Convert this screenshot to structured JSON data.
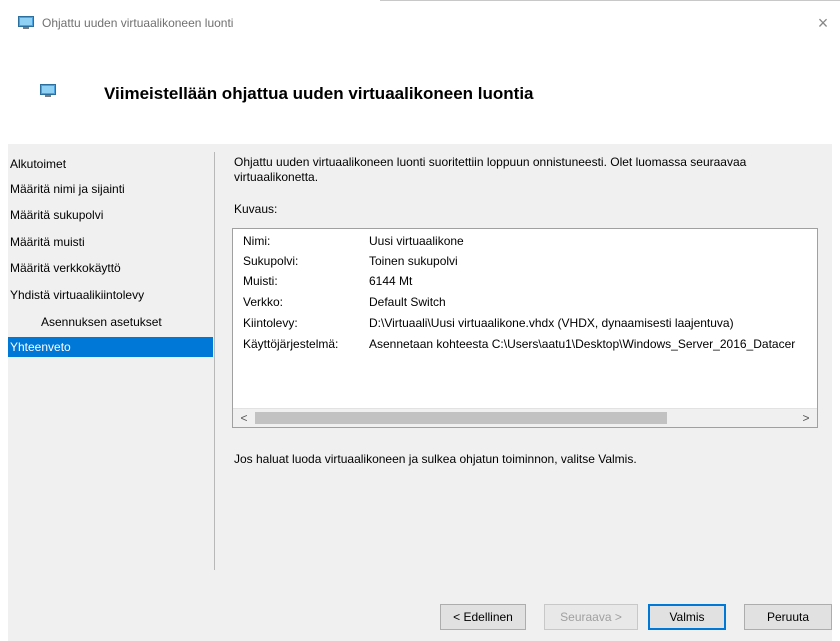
{
  "window": {
    "title": "Ohjattu uuden virtuaalikoneen luonti",
    "close_glyph": "×"
  },
  "header": {
    "title": "Viimeistellään ohjattua uuden virtuaalikoneen luontia"
  },
  "nav": {
    "items": [
      {
        "label": "Alkutoimet",
        "selected": false
      },
      {
        "label": "Määritä nimi ja sijainti",
        "selected": false
      },
      {
        "label": "Määritä sukupolvi",
        "selected": false
      },
      {
        "label": "Määritä muisti",
        "selected": false
      },
      {
        "label": "Määritä verkkokäyttö",
        "selected": false
      },
      {
        "label": "Yhdistä virtuaalikiintolevy",
        "selected": false
      },
      {
        "label": "Asennuksen asetukset",
        "selected": false
      },
      {
        "label": "Yhteenveto",
        "selected": true
      }
    ]
  },
  "content": {
    "intro": "Ohjattu uuden virtuaalikoneen luonti suoritettiin loppuun onnistuneesti. Olet luomassa seuraavaa virtuaalikonetta.",
    "description_label": "Kuvaus:",
    "summary": [
      {
        "key": "Nimi:",
        "value": "Uusi virtuaalikone"
      },
      {
        "key": "Sukupolvi:",
        "value": "Toinen sukupolvi"
      },
      {
        "key": "Muisti:",
        "value": "6144 Mt"
      },
      {
        "key": "Verkko:",
        "value": "Default Switch"
      },
      {
        "key": "Kiintolevy:",
        "value": "D:\\Virtuaali\\Uusi virtuaalikone.vhdx (VHDX, dynaamisesti laajentuva)"
      },
      {
        "key": "Käyttöjärjestelmä:",
        "value": "Asennetaan kohteesta C:\\Users\\aatu1\\Desktop\\Windows_Server_2016_Datacer"
      }
    ],
    "scroll_left": "<",
    "scroll_right": ">",
    "outro": "Jos haluat luoda virtuaalikoneen ja sulkea ohjatun toiminnon, valitse Valmis."
  },
  "buttons": {
    "previous": "< Edellinen",
    "next": "Seuraava >",
    "finish": "Valmis",
    "cancel": "Peruuta"
  },
  "colors": {
    "selection": "#0078d7",
    "panel_background": "#f0f0f0"
  }
}
